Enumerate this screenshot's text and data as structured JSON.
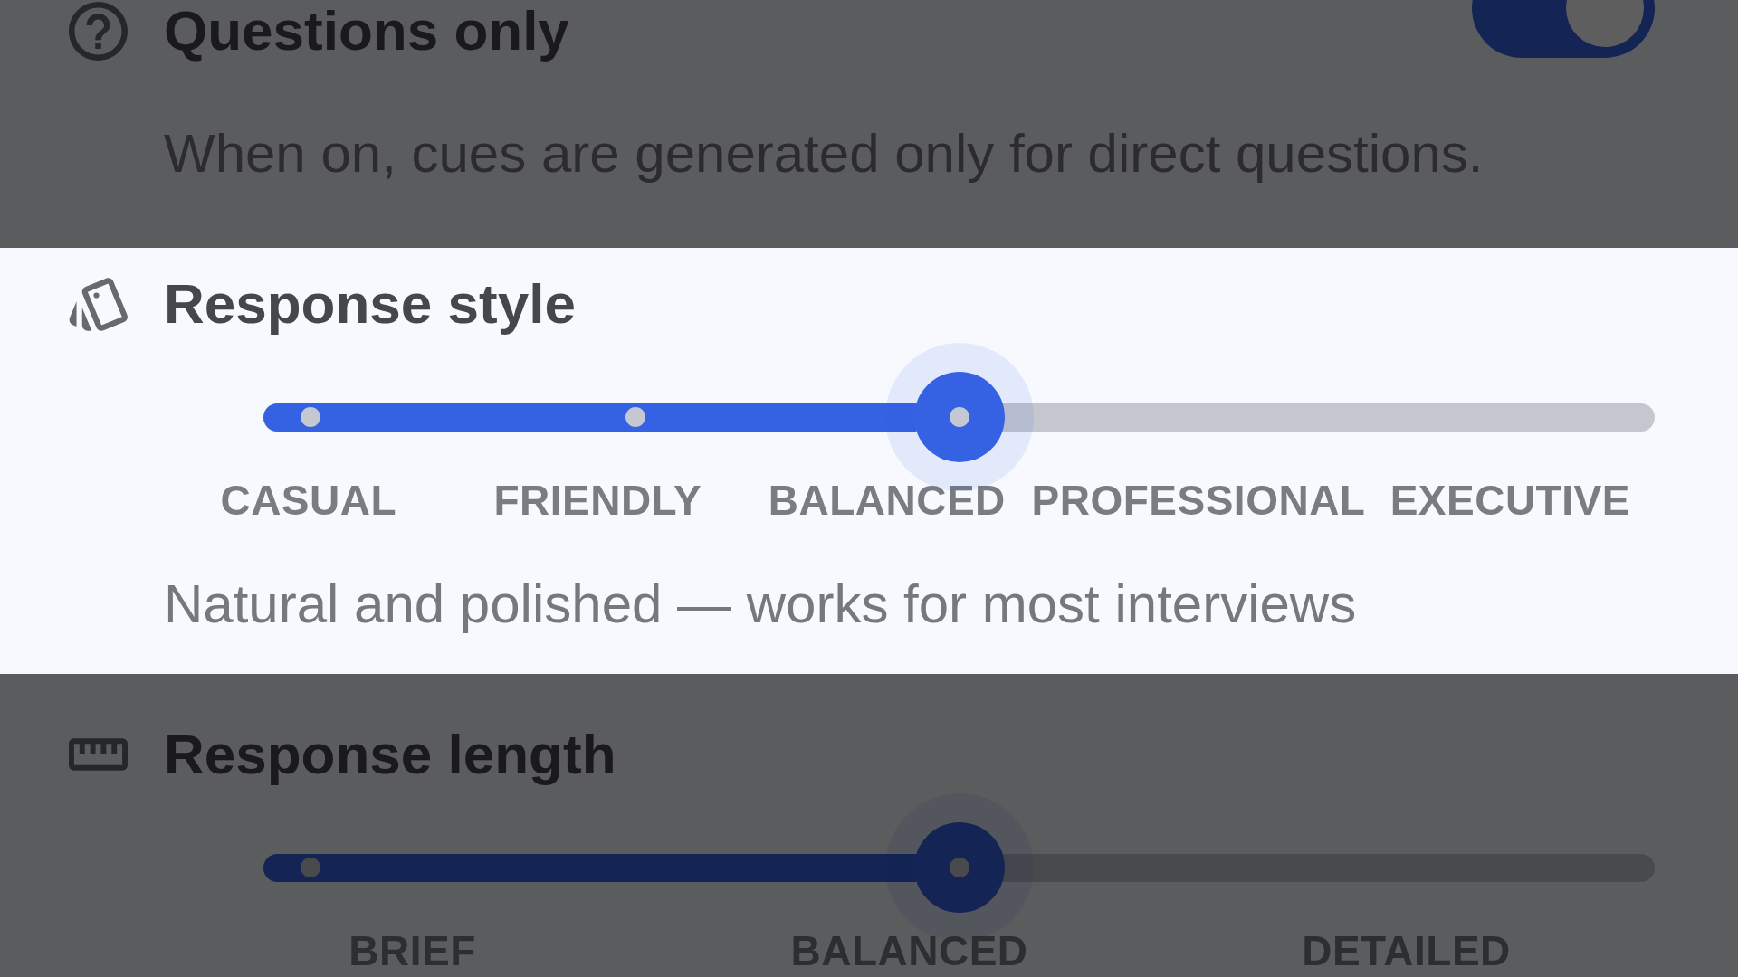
{
  "sections": [
    {
      "kind": "toggle",
      "title": "Questions only",
      "on": true,
      "highlighted": false,
      "description": "When on, cues are generated only for direct questions."
    },
    {
      "kind": "slider",
      "title": "Response style",
      "highlighted": true,
      "slider": {
        "level": 0.5,
        "options": [
          "CASUAL",
          "FRIENDLY",
          "BALANCED",
          "PROFESSIONAL",
          "EXECUTIVE"
        ]
      },
      "description": "Natural and polished — works for most interviews"
    },
    {
      "kind": "slider",
      "title": "Response length",
      "highlighted": false,
      "slider": {
        "level": 0.5,
        "options": [
          "BRIEF",
          "BALANCED",
          "DETAILED"
        ]
      }
    }
  ]
}
